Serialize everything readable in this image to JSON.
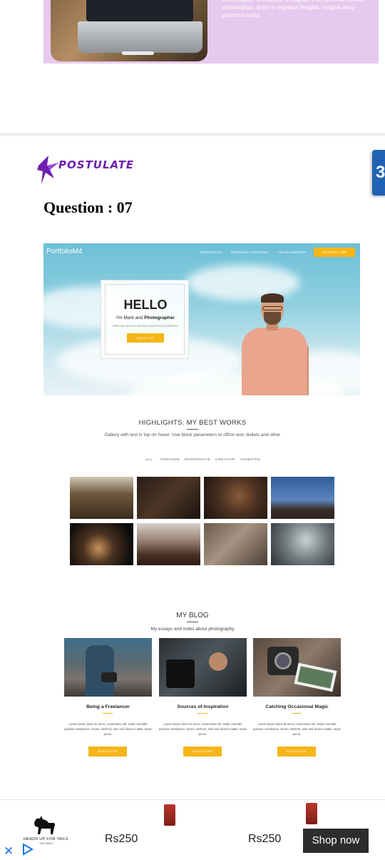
{
  "top_card": {
    "text": "scelerisque. In lobortis, a sagittis eros gravida. Donec consectetur, dolor in egestas feugiat, magna arcu pharetra tortor."
  },
  "logo": {
    "text": "POSTULATE",
    "color": "#6d1fb0"
  },
  "css_badge": {
    "glyph": "3"
  },
  "question": "Question : 07",
  "hero": {
    "brand": "PortfolioM4",
    "nav": [
      "PORTFOLIO",
      "WORKING PROCESS",
      "ACHIEVEMENTS"
    ],
    "contact": "CONTACT ME",
    "hello_title": "HELLO",
    "hello_sub_prefix": "I'm Mark and ",
    "hello_sub_bold": "Photographer",
    "hello_small": "SPECIALIZED IN DESIGN AND PHOTOGRAPHY",
    "hello_button": "ABOUT ME",
    "accent": "#f6b619"
  },
  "highlights": {
    "title": "HIGHLIGHTS: MY BEST WORKS",
    "subtitle": "Gallery with text in top on hover. Use block parameters to off/on text, bullets and other",
    "filters": [
      "ALL",
      "AWESOME",
      "RESPONSIVE",
      "CREATIVE",
      "ANIMATED"
    ]
  },
  "blog": {
    "title": "MY BLOG",
    "subtitle": "My essays and notes about photography",
    "posts": [
      {
        "title": "Being a Freelancer",
        "text": "Lorem ipsum dolor sit amet, consectetur elit. Nulla convallis pulvinar vestibulum. Donec eleifend, sem sed dictum mattis, turpis purus.",
        "button": "READ MORE"
      },
      {
        "title": "Sources of Inspiration",
        "text": "Lorem ipsum dolor sit amet, consectetur elit. Nulla convallis pulvinar vestibulum. Donec eleifend, sem sed dictum mattis, turpis purus.",
        "button": "READ MORE"
      },
      {
        "title": "Catching Occasional Magic",
        "text": "Lorem ipsum dolor sit amet, consectetur elit. Nulla convallis pulvinar vestibulum. Donec eleifend, sem sed dictum mattis, turpis purus.",
        "button": "READ MORE"
      }
    ]
  },
  "ad": {
    "brand": "HEADS UP FOR TAILS",
    "brand_sub": "THE FAMILY",
    "price_1": "Rs250",
    "price_2": "Rs250",
    "cta": "Shop now",
    "close_icon": "close-icon",
    "adchoices_icon": "adchoices-play-icon"
  }
}
